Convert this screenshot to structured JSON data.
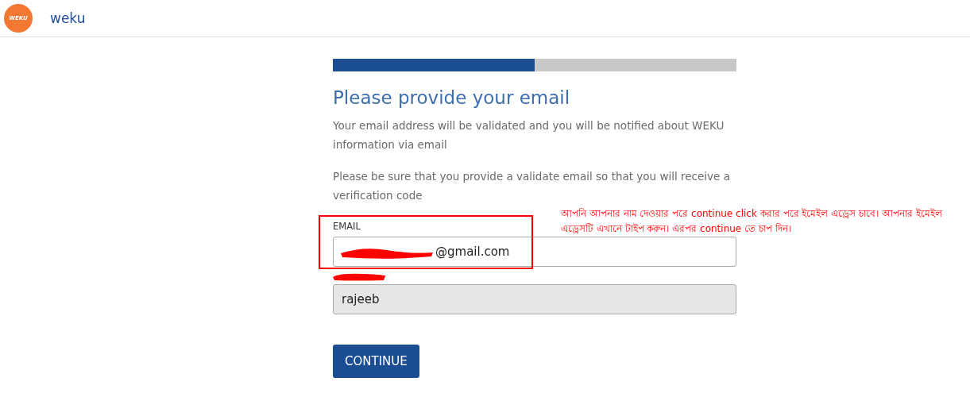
{
  "header": {
    "logo_text": "WEKU",
    "site_name": "weku"
  },
  "progress": {
    "level": 0.5
  },
  "title": "Please provide your email",
  "paragraphs": [
    "Your email address will be validated and you will be notified about WEKU information via email",
    "Please be sure that you provide a validate email so that you will receive a verification code"
  ],
  "email_field": {
    "label": "EMAIL",
    "value": "@gmail.com"
  },
  "name_field": {
    "value": "rajeeb",
    "disabled": true
  },
  "button": "CONTINUE",
  "annotation": {
    "note": "আপনি আপনার নাম দেওয়ার পরে continue click করার পরে ইমেইল এড্রেস চাবে। আপনার ইমেইল এড্রেসটি এখানে টাইপ করুন। এরপর continue তে চাপ দিন।"
  }
}
